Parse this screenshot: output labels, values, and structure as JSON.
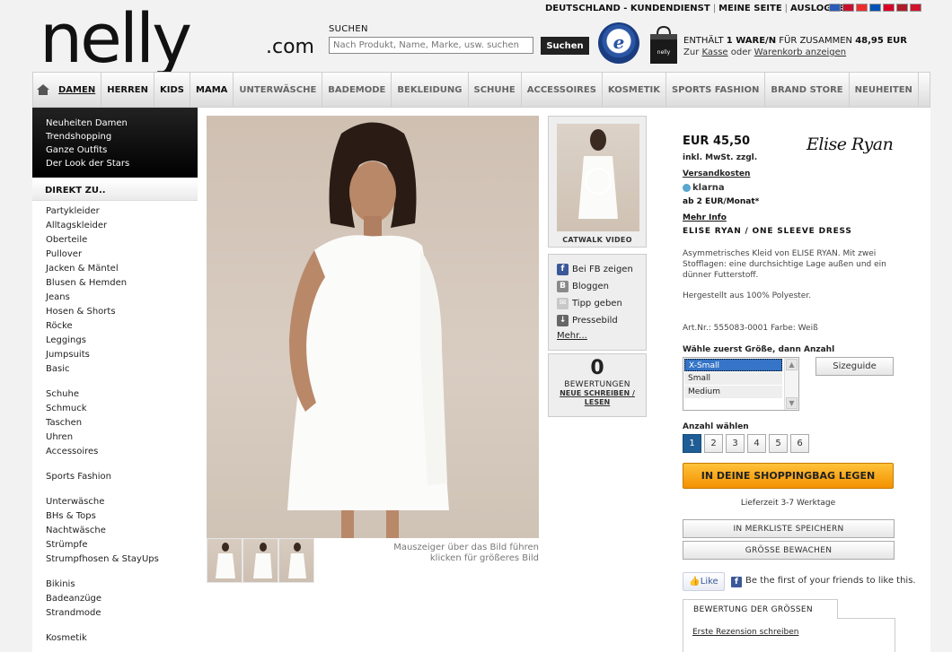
{
  "header": {
    "logo": "nelly",
    "logo_suffix": ".com",
    "top_links": [
      "DEUTSCHLAND - KUNDENDIENST",
      "MEINE SEITE",
      "AUSLOGGEN"
    ],
    "search": {
      "label": "SUCHEN",
      "placeholder": "Nach Produkt, Name, Marke, usw. suchen",
      "button": "Suchen"
    },
    "trusted_badge": "e",
    "cart": {
      "line1_prefix": "ENTHÄLT ",
      "line1_count": "1 WARE/N",
      "line1_mid": " FÜR ZUSAMMEN ",
      "line1_total": "48,95 EUR",
      "line2_prefix": "Zur ",
      "checkout_link": "Kasse",
      "line2_mid": " oder ",
      "cart_link": "Warenkorb anzeigen"
    },
    "flag_colors": [
      "#2b5bb8",
      "#c8102e",
      "#ef2b2d",
      "#0052b4",
      "#d80027",
      "#ae1c28",
      "#cf142b"
    ]
  },
  "nav": {
    "items": [
      {
        "label": "DAMEN",
        "active": true
      },
      {
        "label": "HERREN"
      },
      {
        "label": "KIDS"
      },
      {
        "label": "MAMA"
      },
      {
        "label": "UNTERWÄSCHE"
      },
      {
        "label": "BADEMODE"
      },
      {
        "label": "BEKLEIDUNG"
      },
      {
        "label": "SCHUHE"
      },
      {
        "label": "ACCESSOIRES"
      },
      {
        "label": "KOSMETIK"
      },
      {
        "label": "SPORTS FASHION"
      },
      {
        "label": "BRAND STORE"
      },
      {
        "label": "NEUHEITEN"
      }
    ]
  },
  "sidebar": {
    "featured": [
      "Neuheiten Damen",
      "Trendshopping",
      "Ganze Outfits",
      "Der Look der Stars"
    ],
    "direkt_label": "DIREKT ZU..",
    "groups": [
      [
        "Partykleider",
        "Alltagskleider",
        "Oberteile",
        "Pullover",
        "Jacken & Mäntel",
        "Blusen & Hemden",
        "Jeans",
        "Hosen & Shorts",
        "Röcke",
        "Leggings",
        "Jumpsuits",
        "Basic"
      ],
      [
        "Schuhe",
        "Schmuck",
        "Taschen",
        "Uhren",
        "Accessoires"
      ],
      [
        "Sports Fashion"
      ],
      [
        "Unterwäsche",
        "BHs & Tops",
        "Nachtwäsche",
        "Strümpfe",
        "Strumpfhosen & StayUps"
      ],
      [
        "Bikinis",
        "Badeanzüge",
        "Strandmode"
      ],
      [
        "Kosmetik"
      ]
    ]
  },
  "gallery": {
    "hint_line1": "Mauszeiger über das Bild führen",
    "hint_line2": "klicken für größeres Bild",
    "video_label": "CATWALK VIDEO"
  },
  "share": {
    "items": [
      {
        "icon": "facebook-icon",
        "label": "Bei FB zeigen"
      },
      {
        "icon": "blog-icon",
        "label": "Bloggen"
      },
      {
        "icon": "mail-icon",
        "label": "Tipp geben"
      },
      {
        "icon": "download-icon",
        "label": "Pressebild"
      }
    ],
    "more": "Mehr..."
  },
  "rating": {
    "count": "0",
    "label": "BEWERTUNGEN",
    "write_link": "NEUE SCHREIBEN / LESEN"
  },
  "product": {
    "price": "EUR 45,50",
    "brand_logo": "Elise Ryan",
    "tax": "inkl. MwSt. zzgl.",
    "shipping_link": "Versandkosten",
    "klarna": "klarna",
    "monthly": "ab 2 EUR/Monat*",
    "more_info": "Mehr Info",
    "name": "ELISE RYAN / ONE SLEEVE DRESS",
    "description": "Asymmetrisches Kleid von ELISE RYAN. Mit zwei Stofflagen: eine durchsichtige Lage außen und ein dünner Futterstoff.",
    "material": "Hergestellt aus 100% Polyester.",
    "article": "Art.Nr.: 555083-0001 Farbe: Weiß"
  },
  "purchase": {
    "size_label": "Wähle zuerst Größe, dann Anzahl",
    "sizes": [
      "X-Small",
      "Small",
      "Medium"
    ],
    "selected_size": "X-Small",
    "sizeguide": "Sizeguide",
    "qty_label": "Anzahl wählen",
    "quantities": [
      "1",
      "2",
      "3",
      "4",
      "5",
      "6"
    ],
    "selected_qty": "1",
    "add_to_bag": "IN DEINE SHOPPINGBAG LEGEN",
    "delivery": "Lieferzeit 3-7 Werktage",
    "wishlist": "IN MERKLISTE SPEICHERN",
    "watch_size": "GRÖSSE BEWACHEN"
  },
  "social": {
    "like": "Like",
    "friends_text": "Be the first of your friends to like this."
  },
  "size_review": {
    "tab": "BEWERTUNG DER GRÖSSEN",
    "write": "Erste Rezension schreiben"
  }
}
